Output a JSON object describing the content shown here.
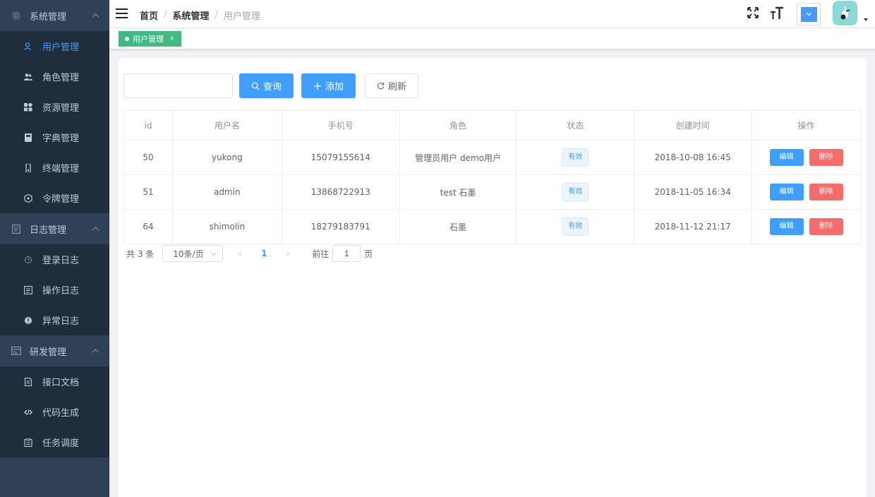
{
  "sidebar": {
    "groups": [
      {
        "title": "系统管理",
        "icon": "gear-icon",
        "items": [
          {
            "label": "用户管理",
            "icon": "user-icon",
            "active": true
          },
          {
            "label": "角色管理",
            "icon": "people-icon"
          },
          {
            "label": "资源管理",
            "icon": "grid-icon"
          },
          {
            "label": "字典管理",
            "icon": "book-icon"
          },
          {
            "label": "终端管理",
            "icon": "phone-icon"
          },
          {
            "label": "令牌管理",
            "icon": "token-icon"
          }
        ]
      },
      {
        "title": "日志管理",
        "icon": "document-icon",
        "items": [
          {
            "label": "登录日志",
            "icon": "clock-icon"
          },
          {
            "label": "操作日志",
            "icon": "list-icon"
          },
          {
            "label": "异常日志",
            "icon": "warning-icon"
          }
        ]
      },
      {
        "title": "研发管理",
        "icon": "window-icon",
        "items": [
          {
            "label": "接口文档",
            "icon": "file-icon"
          },
          {
            "label": "代码生成",
            "icon": "code-icon"
          },
          {
            "label": "任务调度",
            "icon": "clipboard-icon"
          }
        ]
      }
    ]
  },
  "header": {
    "breadcrumb": [
      "首页",
      "系统管理",
      "用户管理"
    ]
  },
  "tags": {
    "active": "用户管理",
    "close": "×"
  },
  "toolbar": {
    "search_value": "",
    "query_label": "查询",
    "add_label": "添加",
    "refresh_label": "刷新"
  },
  "table": {
    "headers": [
      "id",
      "用户名",
      "手机号",
      "角色",
      "状态",
      "创建时间",
      "操作"
    ],
    "rows": [
      {
        "id": "50",
        "username": "yukong",
        "phone": "15079155614",
        "role": "管理员用户 demo用户",
        "status": "有效",
        "created": "2018-10-08 16:45"
      },
      {
        "id": "51",
        "username": "admin",
        "phone": "13868722913",
        "role": "test 石墨",
        "status": "有效",
        "created": "2018-11-05 16:34"
      },
      {
        "id": "64",
        "username": "shimolin",
        "phone": "18279183791",
        "role": "石墨",
        "status": "有效",
        "created": "2018-11-12 21:17"
      }
    ],
    "edit_label": "编辑",
    "delete_label": "删除"
  },
  "pagination": {
    "total": "共 3 条",
    "page_size": "10条/页",
    "current_page": "1",
    "goto_label": "前往",
    "goto_value": "1",
    "page_suffix": "页"
  },
  "colors": {
    "sidebar_bg": "#304156",
    "primary": "#409eff",
    "danger": "#f56c6c",
    "tag_green": "#42b983"
  }
}
